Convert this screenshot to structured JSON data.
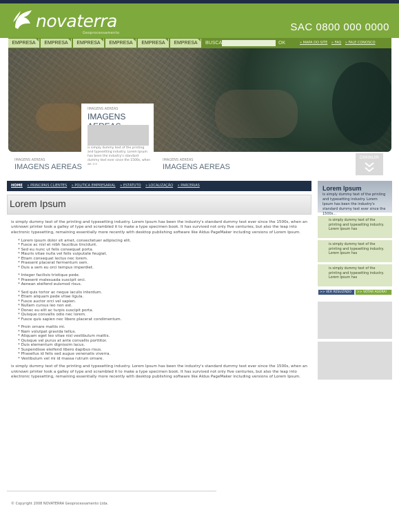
{
  "brand": {
    "name": "novaterra",
    "tagline": "Geoprocessamento",
    "color_primary": "#7ea93c",
    "color_dark": "#1f2f45"
  },
  "header": {
    "sac": "SAC 0800 000 0000"
  },
  "menu": {
    "items": [
      "EMPRESA",
      "EMPRESA",
      "EMPRESA",
      "EMPRESA",
      "EMPRESA",
      "EMPRESA"
    ],
    "search_label": "BUSCA",
    "search_value": "",
    "search_button": "OK",
    "links": [
      "» MAPA DO SITE",
      "» FAQ",
      "» FALE CONOSCO"
    ]
  },
  "banner": {
    "popup": {
      "caption": "IMAGENS AEREAS",
      "title": "IMAGENS AEREAS",
      "text": "is simply dummy text of the printing and typesetting industry. Lorem Ipsum has been the industry's standard dummy text ever since the 1500s, when an >>"
    },
    "thumbs": [
      {
        "caption": "IMAGENS AEREAS",
        "title": "IMAGENS AEREAS"
      },
      {
        "caption": "IMAGENS AEREAS",
        "title": "IMAGENS AEREAS"
      }
    ],
    "collapse_label": "DIMINUIR"
  },
  "breadcrumb": {
    "items": [
      "HOME",
      "» PRINCIPAIS CLIENTES",
      "» POLITICA EMPRESARIAL",
      "» ESTATUTO",
      "» LOCALIZAÇÃO",
      "» PARCERIAS"
    ]
  },
  "page": {
    "title": "Lorem Ipsum",
    "intro": "is simply dummy text of the printing and typesetting industry. Lorem Ipsum has been the industry's standard dummy text ever since the 1500s, when an unknown printer took a galley of type and scrambled it to make a type specimen book. It has survived not only five centuries, but also the leap into electronic typesetting, remaining essentially more recently with desktop publishing software like Aldus PageMaker including versions of Lorem Ipsum.",
    "lists": [
      [
        "* Lorem ipsum dolor sit amet, consectetuer adipiscing elit.",
        "* Fusce ac nisl et nibh faucibus tincidunt.",
        "* Sed eu nunc ut felis consequat porta.",
        "* Mauris vitae nulla vel felis vulputate feugiat.",
        "* Etiam consequat lectus nec lorem.",
        "* Praesent placerat fermentum sem.",
        "* Duis a sem eu orci tempus imperdiet."
      ],
      [
        "* Integer facilisis tristique pede.",
        "* Praesent malesuada suscipit orci.",
        "* Aenean eleifend euismod risus."
      ],
      [
        "* Sed quis tortor ac neque iaculis interdum.",
        "* Etiam aliquam pede vitae ligula.",
        "* Fusce auctor orci vel sapien.",
        "* Nullam cursus leo non est.",
        "* Donec eu elit ac turpis suscipit porta.",
        "* Quisque convallis odio nec lorem.",
        "* Fusce quis sapien nec libero placerat condimentum."
      ],
      [
        "* Proin ornare mattis mi.",
        "* Nam volutpat gravida tellus.",
        "* Aliquam eget leo vitae nisl vestibulum mattis.",
        "* Quisque vel purus at ante convallis porttitor.",
        "* Duis elementum dignissim lacus.",
        "* Suspendisse eleifend libero dapibus risus.",
        "* Phasellus id felis sed augue venenatis viverra.",
        "* Vestibulum vel mi id massa rutrum ornare."
      ]
    ],
    "outro": "is simply dummy text of the printing and typesetting industry. Lorem Ipsum has been the industry's standard dummy text ever since the 1500s, when an unknown printer took a galley of type and scrambled it to make a type specimen book. It has survived not only five centuries, but also the leap into electronic typesetting, remaining essentially more recently with desktop publishing software like Aldus PageMaker including versions of Lorem Ipsum."
  },
  "sidebar": {
    "title": "Lorem Ipsum",
    "subtitle": "is simply dummy text of the printing and typesetting industry. Lorem Ipsum has been the industry's standard dummy text ever since the 1500s...",
    "items": [
      "is simply dummy text of the printing and typesetting industry. Lorem Ipsum has",
      "is simply dummy text of the printing and typesetting industry. Lorem Ipsum has",
      "is simply dummy text of the printing and typesetting industry. Lorem Ipsum has"
    ],
    "btn_results": ">> VER RESULTADO",
    "btn_vote": ">> VOTAR AGORA!"
  },
  "footer": {
    "copyright": "© Copyright 2008 NOVATERRA Geoprocessamento Ltda."
  }
}
